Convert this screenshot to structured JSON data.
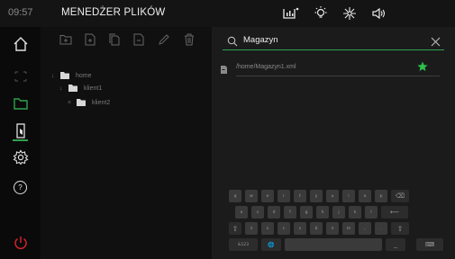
{
  "status": {
    "time": "09:57"
  },
  "header": {
    "title": "MENEDŻER PLIKÓW"
  },
  "top_icons": [
    "usb-status-icon",
    "light-icon",
    "fan-icon",
    "speaker-icon"
  ],
  "sidebar": {
    "items": [
      {
        "icon": "home-icon"
      },
      {
        "icon": "grid-icon"
      },
      {
        "icon": "folder-icon",
        "active": true
      },
      {
        "icon": "door-icon"
      },
      {
        "icon": "settings-icon"
      },
      {
        "icon": "help-icon"
      },
      {
        "icon": "power-icon"
      }
    ],
    "help_label": "?"
  },
  "toolbar": {
    "items": [
      "new-folder-icon",
      "new-file-icon",
      "copy-icon",
      "delete-file-icon",
      "edit-icon",
      "trash-icon"
    ]
  },
  "tree": [
    {
      "label": "home",
      "arrow": "↓",
      "level": 0
    },
    {
      "label": "klient1",
      "arrow": "↓",
      "level": 1
    },
    {
      "label": "klient2",
      "arrow": "×",
      "level": 1
    }
  ],
  "search": {
    "value": "Magazyn"
  },
  "results": [
    {
      "path": "/home/Magazyn1.xml",
      "favorite": true
    }
  ],
  "keyboard": {
    "row1": [
      "q",
      "w",
      "e",
      "r",
      "t",
      "y",
      "u",
      "i",
      "o",
      "p",
      "⌫"
    ],
    "row2": [
      "a",
      "s",
      "d",
      "f",
      "g",
      "h",
      "j",
      "k",
      "l",
      "⟵"
    ],
    "row3": [
      "⇧",
      "z",
      "x",
      "c",
      "v",
      "b",
      "n",
      "m",
      ",",
      ".",
      "⇧"
    ],
    "row4": [
      "&123",
      "🌐",
      "",
      "_",
      "⌨"
    ]
  },
  "colors": {
    "accent": "#2fa14f",
    "power": "#d2232a",
    "star": "#2ec04a"
  }
}
